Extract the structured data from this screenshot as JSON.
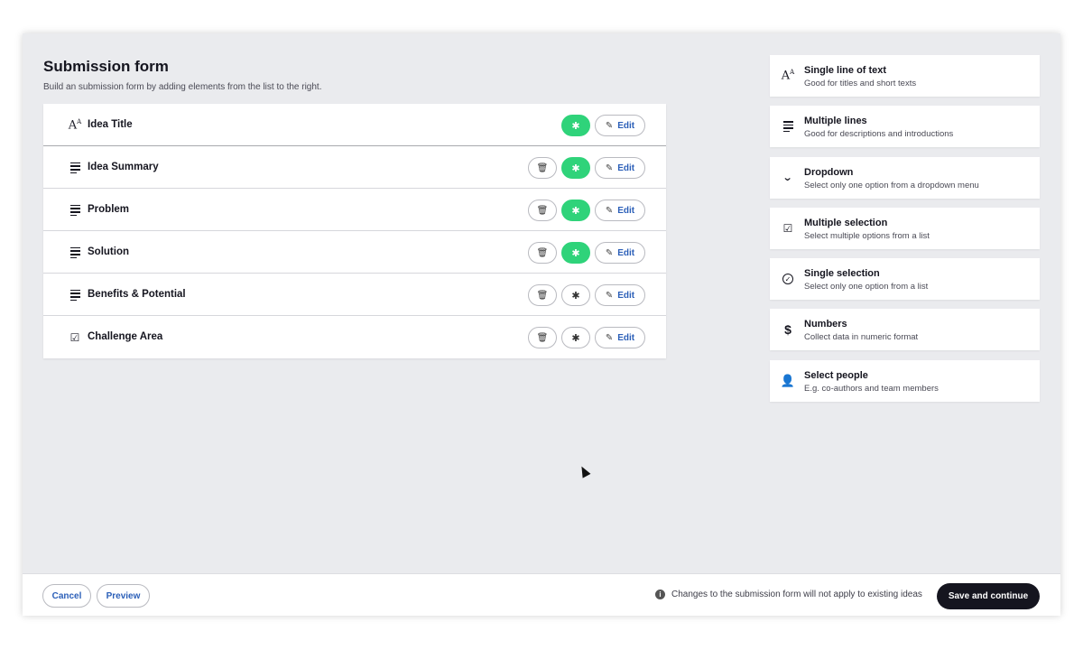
{
  "header": {
    "title": "Submission form",
    "subtitle": "Build an submission form by adding elements from the list to the right."
  },
  "form_fields": [
    {
      "label": "Idea Title",
      "icon": "text-size-icon",
      "deletable": false,
      "required": true
    },
    {
      "label": "Idea Summary",
      "icon": "lines-icon",
      "deletable": true,
      "required": true
    },
    {
      "label": "Problem",
      "icon": "lines-icon",
      "deletable": true,
      "required": true
    },
    {
      "label": "Solution",
      "icon": "lines-icon",
      "deletable": true,
      "required": true
    },
    {
      "label": "Benefits & Potential",
      "icon": "lines-icon",
      "deletable": true,
      "required": false
    },
    {
      "label": "Challenge Area",
      "icon": "checkbox-icon",
      "deletable": true,
      "required": false
    }
  ],
  "row_actions": {
    "edit_label": "Edit",
    "required_glyph": "✱",
    "trash_glyph": "🗑",
    "pen_glyph": "✎"
  },
  "palette": [
    {
      "title": "Single line of text",
      "desc": "Good for titles and short texts",
      "icon": "text-size-icon"
    },
    {
      "title": "Multiple lines",
      "desc": "Good for descriptions and introductions",
      "icon": "lines-icon"
    },
    {
      "title": "Dropdown",
      "desc": "Select only one option from a dropdown menu",
      "icon": "chevron-down-icon"
    },
    {
      "title": "Multiple selection",
      "desc": "Select multiple options from a list",
      "icon": "checkbox-icon"
    },
    {
      "title": "Single selection",
      "desc": "Select only one option from a list",
      "icon": "radio-check-icon"
    },
    {
      "title": "Numbers",
      "desc": "Collect data in numeric format",
      "icon": "dollar-icon"
    },
    {
      "title": "Select people",
      "desc": "E.g. co-authors and team members",
      "icon": "person-icon"
    }
  ],
  "footer": {
    "cancel_label": "Cancel",
    "preview_label": "Preview",
    "notice": "Changes to the submission form will not apply to existing ideas",
    "save_label": "Save and continue"
  },
  "colors": {
    "required_on": "#2fd37a",
    "link": "#2b5fb8",
    "primary_button": "#15151f",
    "canvas": "#eaebee"
  }
}
